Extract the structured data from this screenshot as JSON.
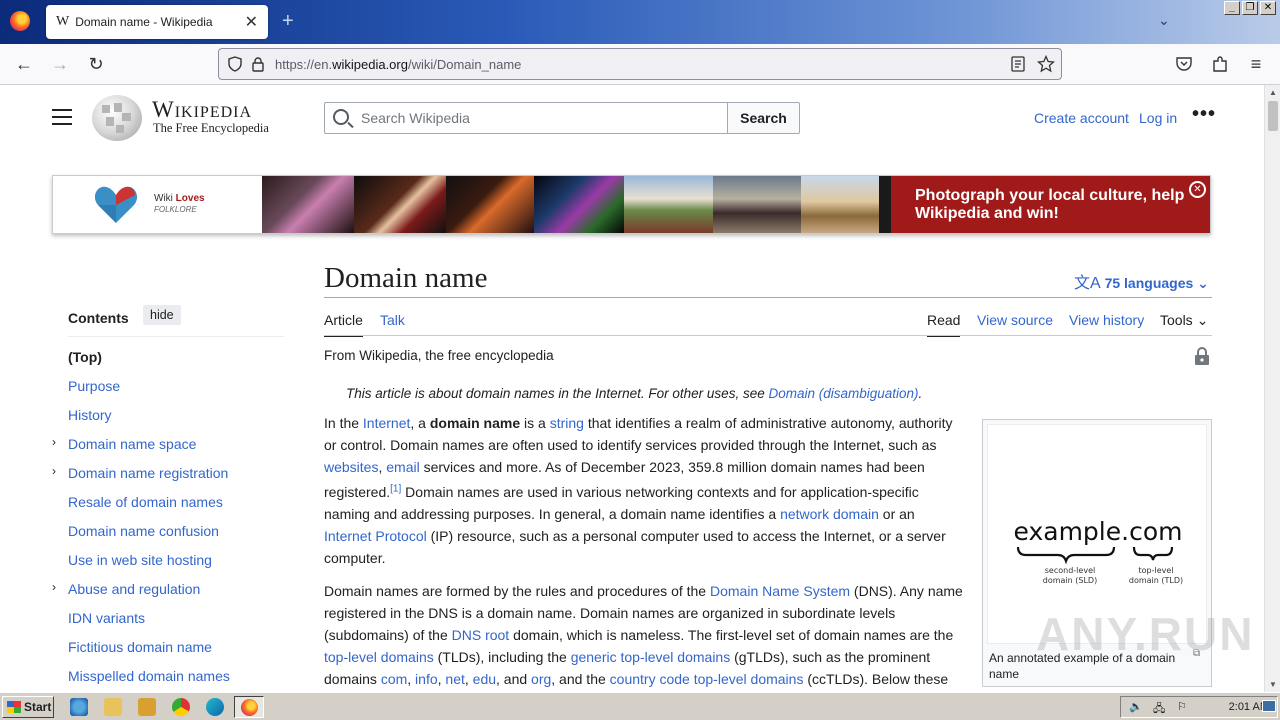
{
  "browser": {
    "tab_title": "Domain name - Wikipedia",
    "tab_favicon": "W",
    "url_prefix": "https://en.",
    "url_domain": "wikipedia.org",
    "url_path": "/wiki/Domain_name",
    "window_buttons": [
      "_",
      "❐",
      "✕"
    ]
  },
  "header": {
    "wordmark": "Wikipedia",
    "tagline": "The Free Encyclopedia",
    "search_placeholder": "Search Wikipedia",
    "search_button": "Search",
    "create_account": "Create account",
    "log_in": "Log in",
    "more": "•••"
  },
  "banner": {
    "logo_line1_a": "Wiki",
    "logo_line1_b": "Loves",
    "logo_line2": "FOLKLORE",
    "message": "Photograph your local culture, help Wikipedia and win!",
    "close": "✕"
  },
  "article": {
    "title": "Domain name",
    "languages": "75 languages",
    "tabs_left": [
      "Article",
      "Talk"
    ],
    "tabs_right": [
      "Read",
      "View source",
      "View history",
      "Tools"
    ],
    "from": "From Wikipedia, the free encyclopedia",
    "hatnote_text": "This article is about domain names in the Internet. For other uses, see ",
    "hatnote_link": "Domain (disambiguation)",
    "hatnote_end": "."
  },
  "toc": {
    "heading": "Contents",
    "hide": "hide",
    "items": [
      "(Top)",
      "Purpose",
      "History",
      "Domain name space",
      "Domain name registration",
      "Resale of domain names",
      "Domain name confusion",
      "Use in web site hosting",
      "Abuse and regulation",
      "IDN variants",
      "Fictitious domain name",
      "Misspelled domain names"
    ]
  },
  "infobox": {
    "image_main": "example.com",
    "sld_label_1": "second-level",
    "sld_label_2": "domain (SLD)",
    "tld_label_1": "top-level",
    "tld_label_2": "domain (TLD)",
    "caption": "An annotated example of a domain name"
  },
  "taskbar": {
    "start": "Start",
    "clock": "2:01 AM"
  },
  "watermark": "ANY.RUN"
}
